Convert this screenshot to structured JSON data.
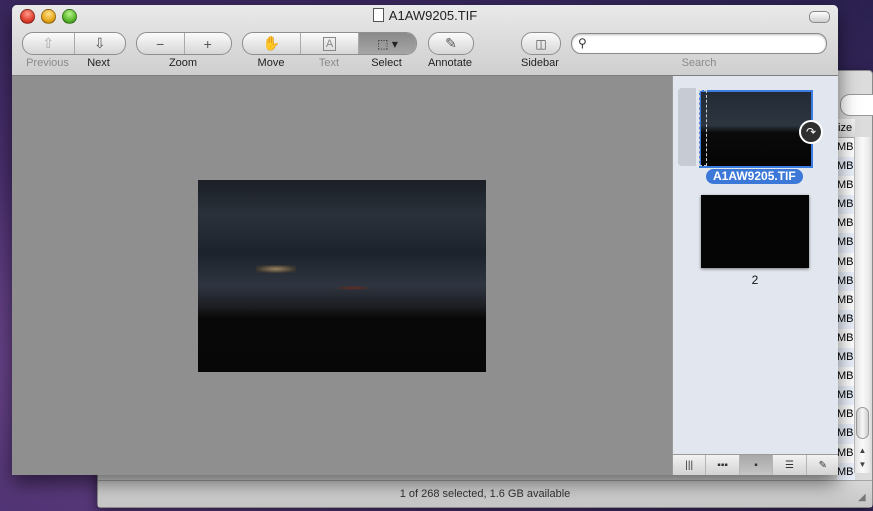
{
  "window": {
    "title": "A1AW9205.TIF"
  },
  "toolbar": {
    "previous_label": "Previous",
    "next_label": "Next",
    "zoom_label": "Zoom",
    "move_label": "Move",
    "text_label": "Text",
    "select_label": "Select",
    "annotate_label": "Annotate",
    "sidebar_label": "Sidebar",
    "search_label": "Search",
    "search_value": ""
  },
  "sidebar": {
    "items": [
      {
        "label": "A1AW9205.TIF",
        "selected": true
      },
      {
        "label": "2",
        "selected": false
      }
    ]
  },
  "background_window": {
    "column_header": "ize",
    "cells": [
      "MB",
      "MB",
      "MB",
      "MB",
      "MB",
      "MB",
      "MB",
      "MB",
      "MB",
      "MB",
      "MB",
      "MB",
      "MB",
      "MB",
      "MB",
      "MB",
      "MB",
      "MB"
    ],
    "status": "1 of 268 selected, 1.6 GB available"
  },
  "colors": {
    "selection": "#3b78d8",
    "content_bg": "#8f8f8f",
    "sidebar_bg": "#e2e7ef"
  }
}
